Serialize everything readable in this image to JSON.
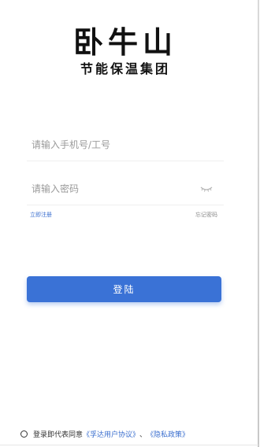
{
  "brand": {
    "logo_main": "卧牛山",
    "logo_sub": "节能保温集团"
  },
  "form": {
    "phone_placeholder": "请输入手机号/工号",
    "password_placeholder": "请输入密码",
    "register_label": "立即注册",
    "forgot_label": "忘记密码",
    "login_label": "登陆"
  },
  "agreement": {
    "prefix": "登录即代表同意",
    "user_agreement": "《孚达用户协议》",
    "separator": "、",
    "privacy_policy": "《隐私政策》"
  },
  "colors": {
    "accent": "#3a72d6",
    "link": "#3b6fcf"
  }
}
